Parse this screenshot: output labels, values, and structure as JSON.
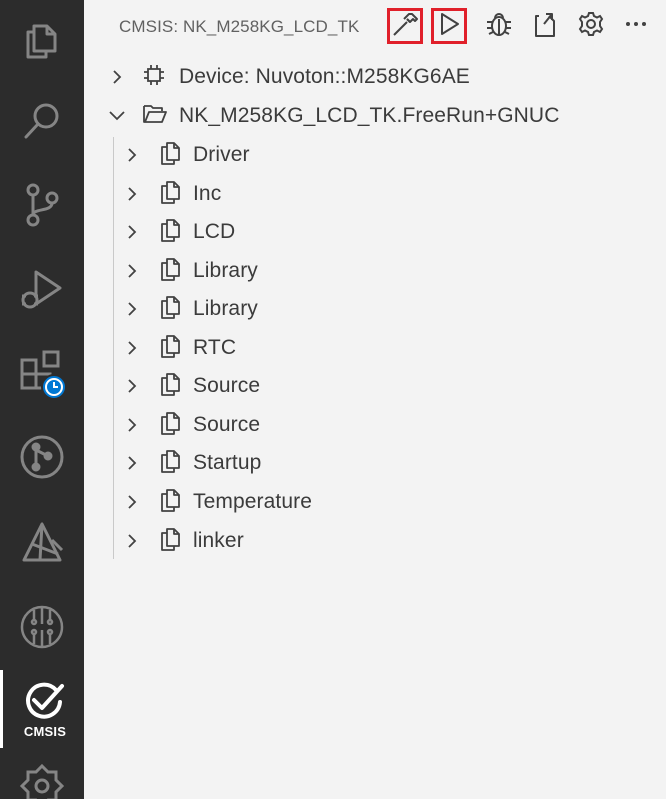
{
  "activity_bar": {
    "items": [
      {
        "name": "explorer",
        "icon": "files-icon"
      },
      {
        "name": "search",
        "icon": "search-icon"
      },
      {
        "name": "source-control",
        "icon": "source-control-icon"
      },
      {
        "name": "run-and-debug",
        "icon": "run-debug-icon"
      },
      {
        "name": "extensions",
        "icon": "extensions-clock-icon"
      },
      {
        "name": "git-graph",
        "icon": "git-graph-icon"
      },
      {
        "name": "arm-tools",
        "icon": "arm-tools-icon"
      },
      {
        "name": "device-manager",
        "icon": "chip-circle-icon"
      },
      {
        "name": "cmsis",
        "icon": "cmsis-check-icon",
        "label": "CMSIS",
        "active": true
      },
      {
        "name": "settings-extension",
        "icon": "gear-outline-icon"
      }
    ]
  },
  "header": {
    "title": "CMSIS: NK_M258KG_LCD_TK",
    "actions": [
      {
        "name": "build",
        "icon": "hammer-icon",
        "highlighted": true
      },
      {
        "name": "run",
        "icon": "play-icon",
        "highlighted": true
      },
      {
        "name": "debug",
        "icon": "bug-icon",
        "highlighted": false
      },
      {
        "name": "open-csolution",
        "icon": "open-file-icon",
        "highlighted": false
      },
      {
        "name": "manage-solution",
        "icon": "gear-icon",
        "highlighted": false
      },
      {
        "name": "more",
        "icon": "ellipsis-icon",
        "highlighted": false
      }
    ]
  },
  "tree": {
    "device": {
      "label": "Device: Nuvoton::M258KG6AE",
      "expanded": false,
      "icon": "chip-icon"
    },
    "project": {
      "label": "NK_M258KG_LCD_TK.FreeRun+GNUC",
      "expanded": true,
      "icon": "folder-open-icon"
    },
    "groups": [
      {
        "label": "Driver"
      },
      {
        "label": "Inc"
      },
      {
        "label": "LCD"
      },
      {
        "label": "Library"
      },
      {
        "label": "Library"
      },
      {
        "label": "RTC"
      },
      {
        "label": "Source"
      },
      {
        "label": "Source"
      },
      {
        "label": "Startup"
      },
      {
        "label": "Temperature"
      },
      {
        "label": "linker"
      }
    ]
  },
  "colors": {
    "activity_bar_bg": "#2c2c2c",
    "sidebar_bg": "#f3f3f3",
    "highlight_border": "#e0202a",
    "badge_blue": "#0078d4"
  }
}
